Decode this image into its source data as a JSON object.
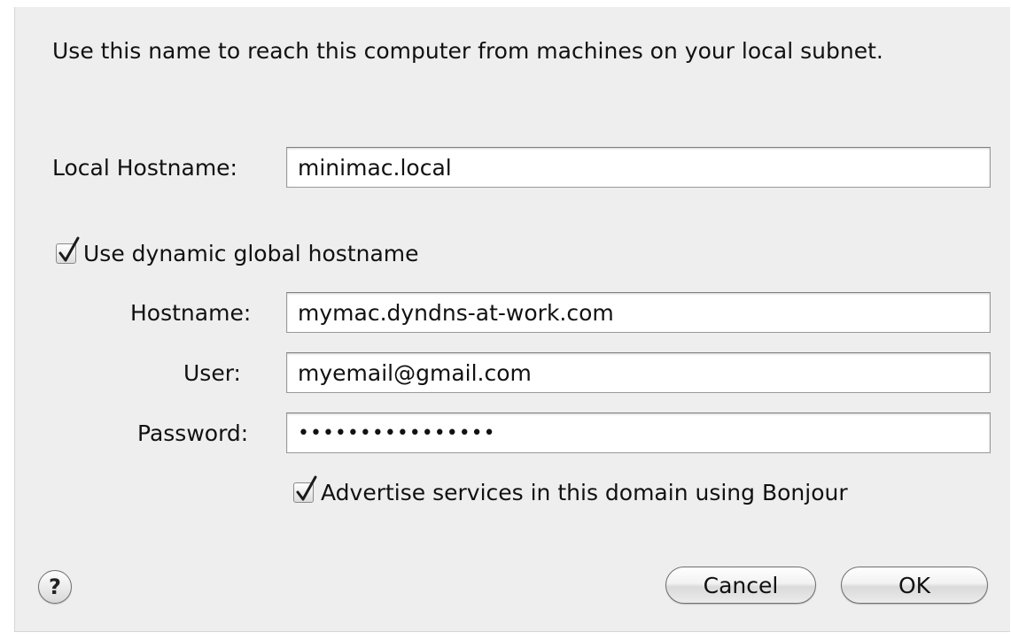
{
  "description": "Use this name to reach this computer from machines on your local subnet.",
  "local_hostname": {
    "label": "Local Hostname:",
    "value": "minimac.local"
  },
  "dynamic_hostname_checkbox": {
    "label": "Use dynamic global hostname",
    "checked": true
  },
  "hostname": {
    "label": "Hostname:",
    "value": "mymac.dyndns-at-work.com"
  },
  "user": {
    "label": "User:",
    "value": "myemail@gmail.com"
  },
  "password": {
    "label": "Password:",
    "value": "••••••••••••••••"
  },
  "bonjour_checkbox": {
    "label": "Advertise services in this domain using Bonjour",
    "checked": true
  },
  "help_button": {
    "label": "?"
  },
  "buttons": {
    "cancel_label": "Cancel",
    "ok_label": "OK"
  }
}
